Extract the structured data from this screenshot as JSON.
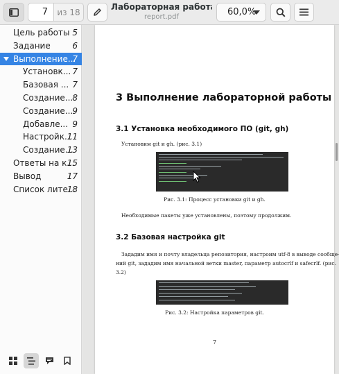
{
  "header": {
    "current_page": "7",
    "page_total": "из 18",
    "title": "Лабораторная работа ...",
    "filename": "report.pdf",
    "zoom": "60,0%"
  },
  "toc": [
    {
      "label": "Цель работы",
      "page": "5",
      "level": 0
    },
    {
      "label": "Задание",
      "page": "6",
      "level": 0
    },
    {
      "label": "Выполнение...",
      "page": "7",
      "level": 0,
      "selected": true,
      "expanded": true
    },
    {
      "label": "Установк...",
      "page": "7",
      "level": 1
    },
    {
      "label": "Базовая ...",
      "page": "7",
      "level": 1
    },
    {
      "label": "Создание...",
      "page": "8",
      "level": 1
    },
    {
      "label": "Создание...",
      "page": "9",
      "level": 1
    },
    {
      "label": "Добавле...",
      "page": "9",
      "level": 1
    },
    {
      "label": "Настройк...",
      "page": "11",
      "level": 1
    },
    {
      "label": "Создание...",
      "page": "13",
      "level": 1
    },
    {
      "label": "Ответы на к...",
      "page": "15",
      "level": 0
    },
    {
      "label": "Вывод",
      "page": "17",
      "level": 0
    },
    {
      "label": "Список лите...",
      "page": "18",
      "level": 0
    }
  ],
  "sidebar_tabs": [
    "thumbnails-icon",
    "outline-icon",
    "annotations-icon",
    "bookmarks-icon"
  ],
  "document": {
    "heading": "3 Выполнение лабораторной работы",
    "sec1_title": "3.1 Установка необходимого ПО (git, gh)",
    "sec1_text": "Установим git и gh. (рис. 3.1)",
    "fig1_caption": "Рис. 3.1: Процесс установки git и gh.",
    "sec1_after": "Необходимые пакеты уже установлены, поэтому продолжим.",
    "sec2_title": "3.2 Базовая настройка git",
    "sec2_line1": "Зададим имя и почту владельца репозитория, настроим utf-8 в выводе сообще-",
    "sec2_line2": "ний git, зададим имя начальной ветки master, параметр autocrlf и safecrlf. (рис.",
    "sec2_line3": "3.2)",
    "fig2_caption": "Рис. 3.2: Настройка параметров git.",
    "page_number": "7"
  },
  "colors": {
    "accent": "#3584e4",
    "terminal_bg": "#2a2a2a"
  }
}
